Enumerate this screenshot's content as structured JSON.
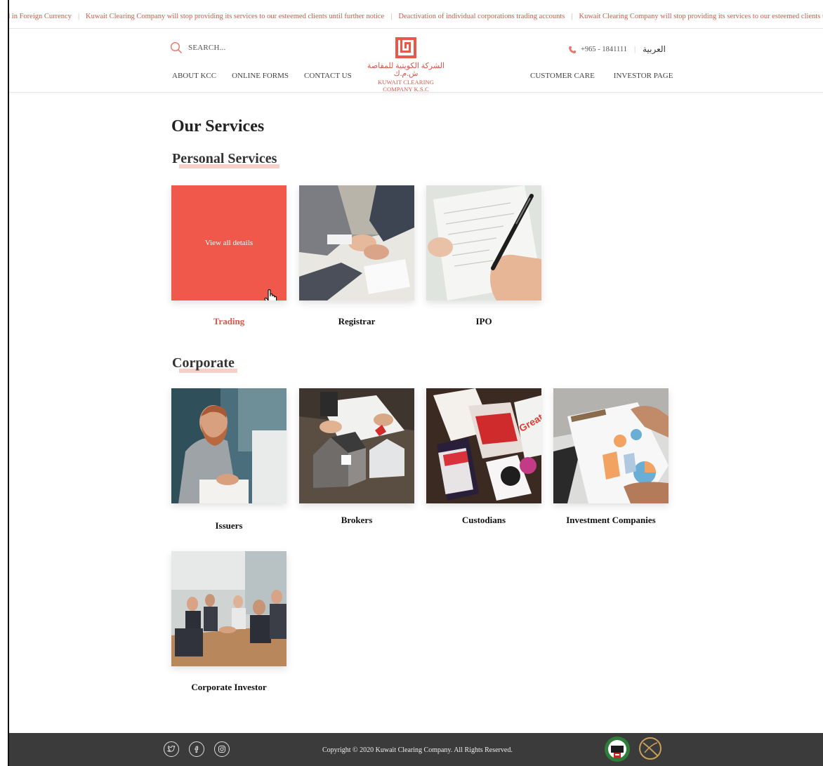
{
  "ticker": {
    "items": [
      "end in Foreign Currency",
      "Kuwait Clearing Company will stop providing its services to our esteemed clients until further notice",
      "Deactivation of individual corporations trading accounts",
      "Kuwait Clearing Company will stop providing its services to our esteemed clients until further notice"
    ]
  },
  "header": {
    "search_placeholder": "SEARCH...",
    "nav_left": [
      "ABOUT KCC",
      "ONLINE FORMS",
      "CONTACT US"
    ],
    "nav_right": [
      "CUSTOMER CARE",
      "INVESTOR PAGE"
    ],
    "logo_arabic": "الشركة الكويتية للمقاصة ش.م.ك",
    "logo_english": "KUWAIT CLEARING COMPANY K.S.C",
    "phone": "+965 - 1841111",
    "language": "العربية"
  },
  "main": {
    "title": "Our Services",
    "personal": {
      "title": "Personal Services",
      "cards": [
        {
          "label": "Trading",
          "overlay": "View all details",
          "active": true
        },
        {
          "label": "Registrar"
        },
        {
          "label": "IPO"
        }
      ]
    },
    "corporate": {
      "title": "Corporate",
      "cards": [
        {
          "label": "Issuers"
        },
        {
          "label": "Brokers"
        },
        {
          "label": "Custodians"
        },
        {
          "label": "Investment Companies"
        },
        {
          "label": "Corporate Investor"
        }
      ]
    }
  },
  "footer": {
    "copyright": "Copyright © 2020 Kuwait Clearing Company. All Rights Reserved.",
    "social_icons": [
      "twitter-icon",
      "facebook-icon",
      "instagram-icon"
    ]
  },
  "colors": {
    "accent": "#f0584b",
    "footer": "#3b3b3b"
  }
}
